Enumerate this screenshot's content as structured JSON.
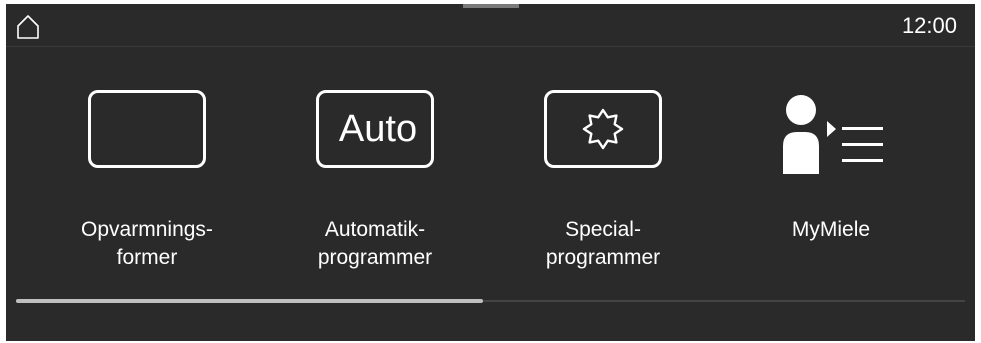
{
  "status_bar": {
    "home_icon": "home-icon",
    "time": "12:00"
  },
  "tiles": [
    {
      "label": "Opvarmnings-\nformer",
      "icon": "heating-modes-frame-icon"
    },
    {
      "label": "Automatik-\nprogrammer",
      "icon": "auto-icon",
      "icon_text": "Auto"
    },
    {
      "label": "Special-\nprogrammer",
      "icon": "special-star-icon"
    },
    {
      "label": "MyMiele",
      "icon": "user-list-icon"
    }
  ],
  "scrollbar": {
    "position_fraction": 0.0,
    "visible_fraction": 0.5
  },
  "colors": {
    "background": "#2a2a2a",
    "foreground": "#ffffff",
    "scroll_thumb": "#bfbfbf"
  }
}
